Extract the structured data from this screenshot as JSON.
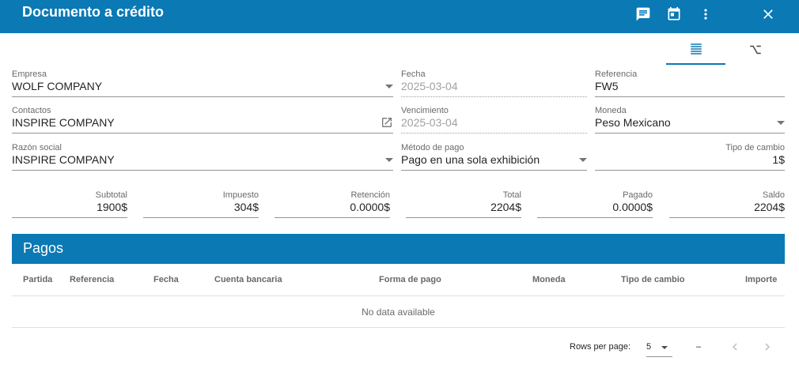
{
  "header": {
    "title": "Documento a crédito",
    "icons": [
      "comment-icon",
      "calendar-icon",
      "more-vert-icon",
      "close-icon"
    ]
  },
  "tabs": [
    {
      "icon": "list-icon",
      "active": true
    },
    {
      "icon": "option-icon",
      "active": false
    }
  ],
  "form": {
    "empresa": {
      "label": "Empresa",
      "value": "WOLF COMPANY"
    },
    "fecha": {
      "label": "Fecha",
      "value": "2025-03-04"
    },
    "referencia": {
      "label": "Referencia",
      "value": "FW5"
    },
    "contactos": {
      "label": "Contactos",
      "value": "INSPIRE COMPANY"
    },
    "vencimiento": {
      "label": "Vencimiento",
      "value": "2025-03-04"
    },
    "moneda": {
      "label": "Moneda",
      "value": "Peso Mexicano"
    },
    "razon_social": {
      "label": "Razón social",
      "value": "INSPIRE COMPANY"
    },
    "metodo_pago": {
      "label": "Método de pago",
      "value": "Pago en una sola exhibición"
    },
    "tipo_cambio": {
      "label": "Tipo de cambio",
      "value": "1$"
    }
  },
  "totals": {
    "subtotal": {
      "label": "Subtotal",
      "value": "1900$"
    },
    "impuesto": {
      "label": "Impuesto",
      "value": "304$"
    },
    "retencion": {
      "label": "Retención",
      "value": "0.0000$"
    },
    "total": {
      "label": "Total",
      "value": "2204$"
    },
    "pagado": {
      "label": "Pagado",
      "value": "0.0000$"
    },
    "saldo": {
      "label": "Saldo",
      "value": "2204$"
    }
  },
  "pagos": {
    "title": "Pagos",
    "columns": [
      "Partida",
      "Referencia",
      "Fecha",
      "Cuenta bancaria",
      "Forma de pago",
      "Moneda",
      "Tipo de cambio",
      "Importe"
    ],
    "no_data": "No data available"
  },
  "pagination": {
    "rows_per_page_label": "Rows per page:",
    "rows_per_page": "5",
    "range": "–"
  },
  "colors": {
    "primary": "#0a79b4"
  }
}
